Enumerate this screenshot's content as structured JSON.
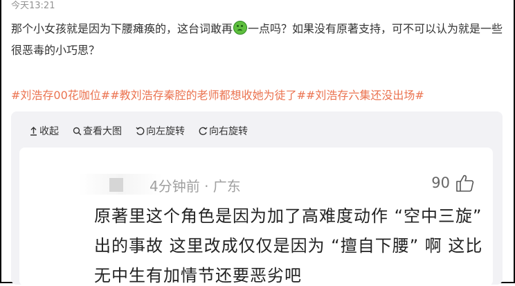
{
  "post": {
    "timestamp": "今天13:21",
    "text_part1": "那个小女孩就是因为下腰瘫痪的，这台词敢再",
    "emoji_name": "sick-face-emoji",
    "text_part2": "一点吗？如果没有原著支持，可不可以认为就是一些很恶毒的小巧思？",
    "hashtags": [
      "#刘浩存00花咖位#",
      "#教刘浩存秦腔的老师都想收她为徒了#",
      "#刘浩存六集还没出场#"
    ]
  },
  "toolbar": {
    "collapse_label": "收起",
    "view_large_label": "查看大图",
    "rotate_left_label": "向左旋转",
    "rotate_right_label": "向右旋转"
  },
  "comment": {
    "meta": "4分钟前 · 广东",
    "likes": "90",
    "body": "原著里这个角色是因为加了高难度动作 “空中三旋” 出的事故 这里改成仅仅是因为 “擅自下腰” 啊 这比无中生有加情节还要恶劣吧"
  },
  "colors": {
    "hashtag": "#eb7350",
    "timestamp": "#939393",
    "media_bg": "#f2f2f5"
  }
}
